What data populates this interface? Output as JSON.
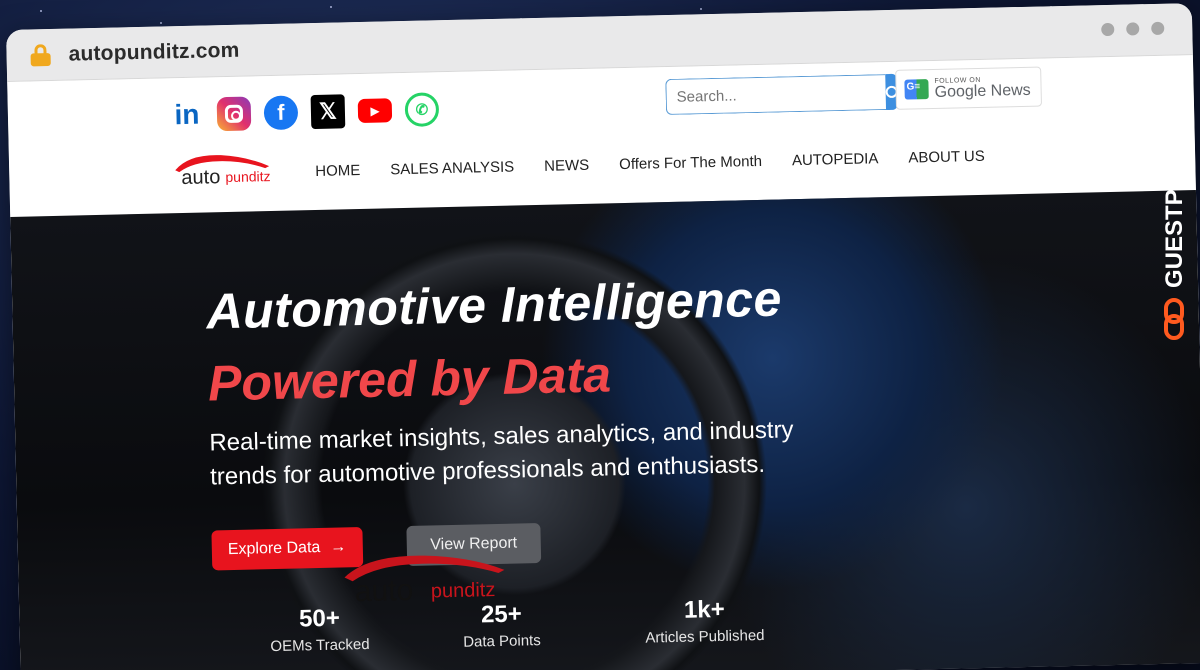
{
  "browser": {
    "url": "autopunditz.com"
  },
  "header": {
    "search_placeholder": "Search...",
    "google_news_small": "FOLLOW ON",
    "google_news_big": "Google News",
    "logo_text_a": "auto",
    "logo_text_b": "punditz",
    "nav": [
      "HOME",
      "SALES ANALYSIS",
      "NEWS",
      "Offers For The Month",
      "AUTOPEDIA",
      "ABOUT US"
    ],
    "socials": [
      "linkedin-icon",
      "instagram-icon",
      "facebook-icon",
      "x-icon",
      "youtube-icon",
      "whatsapp-icon"
    ]
  },
  "hero": {
    "title_line1": "Automotive Intelligence",
    "title_line2": "Powered by Data",
    "subtitle": "Real-time market insights, sales analytics, and industry trends for automotive professionals and enthusiasts.",
    "cta_primary": "Explore Data",
    "cta_secondary": "View Report",
    "stats": [
      {
        "num": "50+",
        "label": "OEMs Tracked"
      },
      {
        "num": "25+",
        "label": "Data Points"
      },
      {
        "num": "1k+",
        "label": "Articles Published"
      }
    ]
  },
  "watermark": {
    "text": "GUESTPOSTLINKS"
  },
  "colors": {
    "accent_red": "#e8141e",
    "headline_red": "#f0474a",
    "search_blue": "#3d8fe0"
  }
}
